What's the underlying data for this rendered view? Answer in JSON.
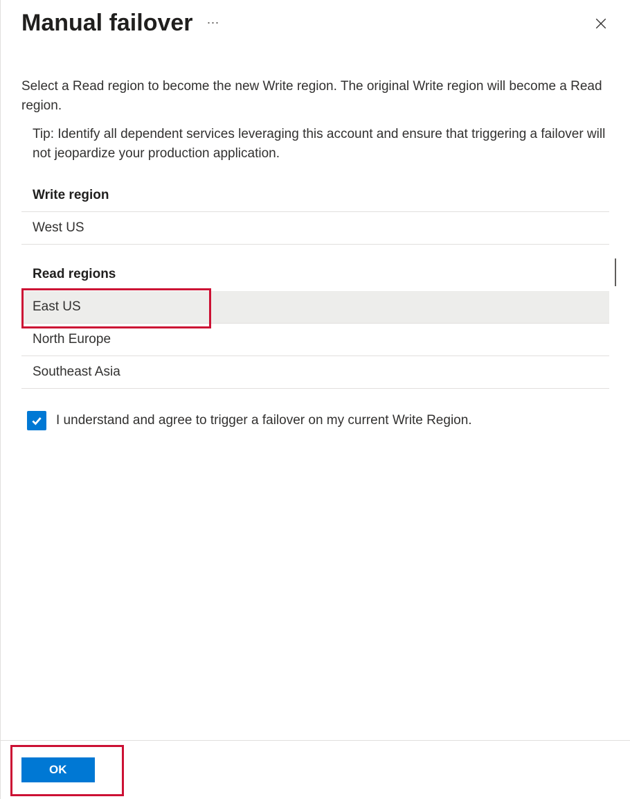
{
  "header": {
    "title": "Manual failover",
    "more_icon": "⋯"
  },
  "description": "Select a Read region to become the new Write region. The original Write region will become a Read region.",
  "tip": "Tip: Identify all dependent services leveraging this account and ensure that triggering a failover will not jeopardize your production application.",
  "write_section": {
    "label": "Write region",
    "region": "West US"
  },
  "read_section": {
    "label": "Read regions",
    "regions": [
      {
        "name": "East US",
        "selected": true
      },
      {
        "name": "North Europe",
        "selected": false
      },
      {
        "name": "Southeast Asia",
        "selected": false
      }
    ]
  },
  "agree": {
    "checked": true,
    "text": "I understand and agree to trigger a failover on my current Write Region."
  },
  "footer": {
    "ok_label": "OK"
  }
}
